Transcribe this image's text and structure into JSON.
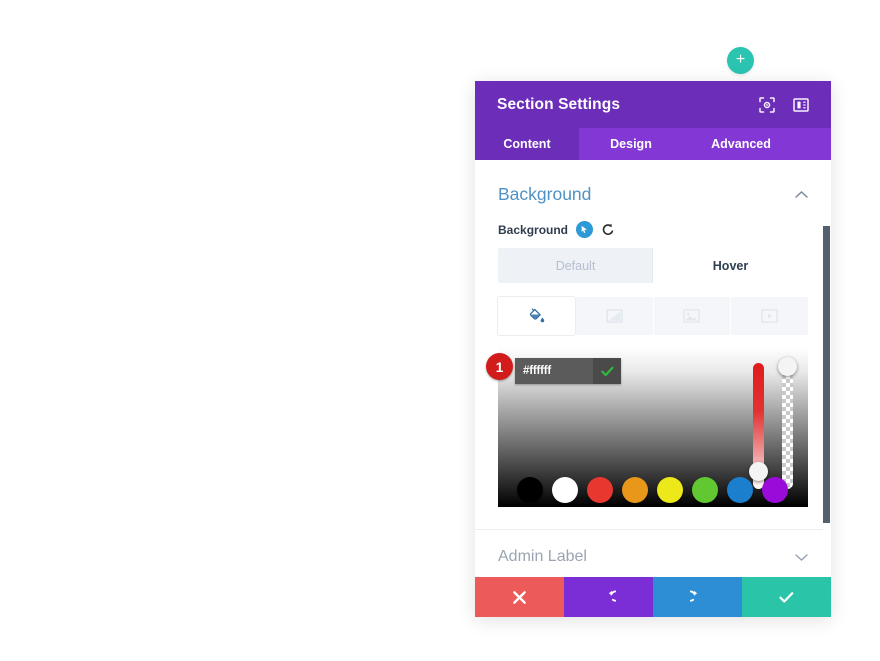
{
  "canvas": {
    "add_section_button": {
      "label": "+",
      "icon": "plus-icon",
      "color": "#2ac4b1"
    }
  },
  "modal": {
    "title": "Section Settings",
    "header_icons": [
      {
        "name": "focus-target-icon"
      },
      {
        "name": "layout-panel-icon"
      }
    ],
    "tabs": [
      {
        "label": "Content",
        "active": true
      },
      {
        "label": "Design",
        "active": false
      },
      {
        "label": "Advanced",
        "active": false
      }
    ],
    "accent_purple": "#6c2eb9",
    "tabbar_purple": "#8338d6",
    "sections": {
      "background": {
        "title": "Background",
        "collapse_icon": "chevron-up-icon",
        "field": {
          "label": "Background",
          "hover_state_icon": "cursor-pointer-icon",
          "reset_icon": "reset-arrow-icon"
        },
        "states": [
          {
            "label": "Default",
            "active": false
          },
          {
            "label": "Hover",
            "active": true
          }
        ],
        "bg_types": [
          {
            "name": "bg-color-icon",
            "active": true
          },
          {
            "name": "bg-gradient-icon",
            "active": false
          },
          {
            "name": "bg-image-icon",
            "active": false
          },
          {
            "name": "bg-video-icon",
            "active": false
          }
        ],
        "color_picker": {
          "hex_value": "#ffffff",
          "hex_placeholder": "#ffffff",
          "confirm_icon": "check-icon",
          "annotation_badge": "1",
          "badge_color": "#d21b1b",
          "hue_slider": "hue-slider",
          "alpha_slider": "alpha-slider",
          "swatches": [
            "#000000",
            "#ffffff",
            "#e8372f",
            "#e8971a",
            "#ece81a",
            "#62c832",
            "#1c7fce",
            "#9a0ad9"
          ]
        }
      },
      "admin_label": {
        "title": "Admin Label",
        "expand_icon": "chevron-down-icon"
      }
    },
    "footer_buttons": [
      {
        "name": "cancel-button",
        "icon": "close-icon",
        "color": "#ec5a5a"
      },
      {
        "name": "undo-button",
        "icon": "undo-arrow-icon",
        "color": "#7c2ed6"
      },
      {
        "name": "redo-button",
        "icon": "redo-arrow-icon",
        "color": "#2d8ed6"
      },
      {
        "name": "save-button",
        "icon": "check-icon",
        "color": "#2ac4a8"
      }
    ]
  }
}
